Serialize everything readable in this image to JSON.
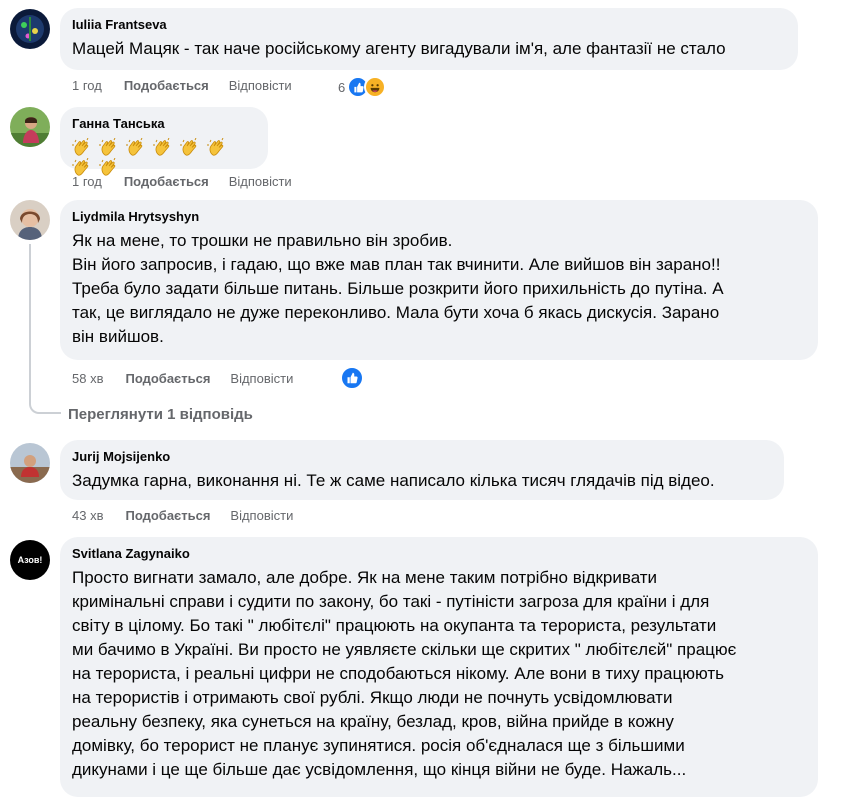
{
  "comments": [
    {
      "author": "Iuliia Frantseva",
      "lines": [
        "Мацей Мацяк - так наче російському агенту вигадували ім'я, але фантазії не стало"
      ],
      "time": "1 год",
      "like_label": "Подобається",
      "reply_label": "Відповісти",
      "reaction_count": "6",
      "reactions": [
        "like-icon",
        "haha-icon"
      ]
    },
    {
      "author": "Ганна Танська",
      "emoji": [
        "clapping-hands",
        "clapping-hands",
        "clapping-hands",
        "clapping-hands",
        "clapping-hands",
        "clapping-hands",
        "clapping-hands",
        "clapping-hands"
      ],
      "time": "1 год",
      "like_label": "Подобається",
      "reply_label": "Відповісти"
    },
    {
      "author": "Liydmila Hrytsyshyn",
      "lines": [
        "Як на мене, то трошки не правильно він зробив.",
        "Він його запросив, і гадаю, що вже мав план так вчинити. Але вийшов він зарано!!",
        "Треба було задати більше питань. Більше розкрити його прихильність до путіна. А",
        "так, це виглядало не дуже переконливо. Мала бути хоча б якась дискусія. Зарано",
        "він вийшов."
      ],
      "time": "58 хв",
      "like_label": "Подобається",
      "reply_label": "Відповісти",
      "reactions": [
        "like-icon"
      ],
      "view_replies": "Переглянути 1 відповідь"
    },
    {
      "author": "Jurij Mojsijenko",
      "lines": [
        "Задумка гарна, виконання ні. Те ж саме написало кілька тисяч глядачів під відео."
      ],
      "time": "43 хв",
      "like_label": "Подобається",
      "reply_label": "Відповісти"
    },
    {
      "author": "Svitlana Zagynaiko",
      "lines": [
        "Просто вигнати замало, але добре. Як на мене таким потрібно відкривати",
        "кримінальні справи і судити по закону, бо такі - путіністи загроза для країни і для",
        "світу в цілому. Бо такі \" любітєлі\" працюють на окупанта та терориста, результати",
        "ми бачимо в Україні. Ви просто не уявляєте скільки ще скритих \" любітєлєй\" працює",
        "на терориста, і реальні цифри не сподобаються нікому. Але вони в тиху працюють",
        "на терористів і отримають свої рублі. Якщо люди не почнуть усвідомлювати",
        "реальну безпеку, яка сунеться на країну, безлад, кров, війна прийде в кожну",
        "домівку, бо терорист не планує зупинятися. росія об'єдналася ще з більшими",
        "дикунами і це ще більше дає усвідомлення, що кінця війни не буде. Нажаль..."
      ],
      "avatar_text": "Азов!"
    }
  ],
  "colors": {
    "bubble": "#f0f2f5",
    "meta": "#65676b",
    "like_blue": "#1877f2",
    "haha_yellow": "#f7b125"
  }
}
